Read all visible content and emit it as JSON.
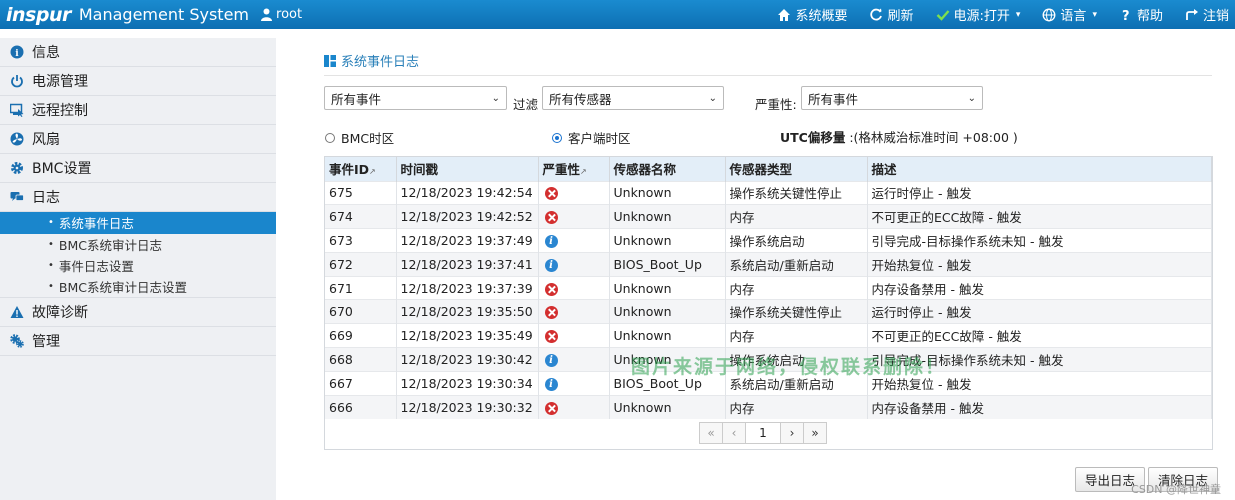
{
  "header": {
    "brand": "inspur",
    "app_name": "Management System",
    "user": "root",
    "nav": [
      {
        "label": "系统概要",
        "icon": "home-icon"
      },
      {
        "label": "刷新",
        "icon": "refresh-icon"
      },
      {
        "label": "电源:打开",
        "icon": "check-icon",
        "caret": "▾"
      },
      {
        "label": "语言",
        "icon": "globe-icon",
        "caret": "▾"
      },
      {
        "label": "帮助",
        "icon": "help-icon"
      },
      {
        "label": "注销",
        "icon": "logout-icon"
      }
    ]
  },
  "sidebar": {
    "items": [
      {
        "label": "信息",
        "icon": "info-icon"
      },
      {
        "label": "电源管理",
        "icon": "power-icon"
      },
      {
        "label": "远程控制",
        "icon": "monitor-icon"
      },
      {
        "label": "风扇",
        "icon": "fan-icon"
      },
      {
        "label": "BMC设置",
        "icon": "gear-icon"
      },
      {
        "label": "日志",
        "icon": "chat-icon"
      }
    ],
    "log_subitems": [
      {
        "label": "系统事件日志",
        "active": true
      },
      {
        "label": "BMC系统审计日志"
      },
      {
        "label": "事件日志设置"
      },
      {
        "label": "BMC系统审计日志设置"
      }
    ],
    "items_after": [
      {
        "label": "故障诊断",
        "icon": "warning-icon"
      },
      {
        "label": "管理",
        "icon": "gears-icon"
      }
    ]
  },
  "main": {
    "title": "系统事件日志",
    "filters": {
      "event_select": "所有事件",
      "filter_label": "过滤",
      "sensor_select": "所有传感器",
      "severity_label": "严重性:",
      "severity_select": "所有事件"
    },
    "timezone": {
      "bmc_label": "BMC时区",
      "client_label": "客户端时区",
      "selected": "client",
      "utc_label": "UTC偏移量",
      "utc_value": ":(格林威治标准时间 +08:00 )"
    },
    "table": {
      "columns": [
        "事件ID",
        "时间戳",
        "严重性",
        "传感器名称",
        "传感器类型",
        "描述"
      ],
      "rows": [
        {
          "id": "675",
          "time": "12/18/2023 19:42:54",
          "sev": "error",
          "sensor": "Unknown",
          "type": "操作系统关键性停止",
          "desc": "运行时停止 - 触发"
        },
        {
          "id": "674",
          "time": "12/18/2023 19:42:52",
          "sev": "error",
          "sensor": "Unknown",
          "type": "内存",
          "desc": "不可更正的ECC故障 - 触发"
        },
        {
          "id": "673",
          "time": "12/18/2023 19:37:49",
          "sev": "info",
          "sensor": "Unknown",
          "type": "操作系统启动",
          "desc": "引导完成-目标操作系统未知 - 触发"
        },
        {
          "id": "672",
          "time": "12/18/2023 19:37:41",
          "sev": "info",
          "sensor": "BIOS_Boot_Up",
          "type": "系统启动/重新启动",
          "desc": "开始热复位 - 触发"
        },
        {
          "id": "671",
          "time": "12/18/2023 19:37:39",
          "sev": "error",
          "sensor": "Unknown",
          "type": "内存",
          "desc": "内存设备禁用 - 触发"
        },
        {
          "id": "670",
          "time": "12/18/2023 19:35:50",
          "sev": "error",
          "sensor": "Unknown",
          "type": "操作系统关键性停止",
          "desc": "运行时停止 - 触发"
        },
        {
          "id": "669",
          "time": "12/18/2023 19:35:49",
          "sev": "error",
          "sensor": "Unknown",
          "type": "内存",
          "desc": "不可更正的ECC故障 - 触发"
        },
        {
          "id": "668",
          "time": "12/18/2023 19:30:42",
          "sev": "info",
          "sensor": "Unknown",
          "type": "操作系统启动",
          "desc": "引导完成-目标操作系统未知 - 触发"
        },
        {
          "id": "667",
          "time": "12/18/2023 19:30:34",
          "sev": "info",
          "sensor": "BIOS_Boot_Up",
          "type": "系统启动/重新启动",
          "desc": "开始热复位 - 触发"
        },
        {
          "id": "666",
          "time": "12/18/2023 19:30:32",
          "sev": "error",
          "sensor": "Unknown",
          "type": "内存",
          "desc": "内存设备禁用 - 触发"
        }
      ]
    },
    "pager": {
      "first": "«",
      "prev": "‹",
      "page": "1",
      "next": "›",
      "last": "»"
    },
    "buttons": {
      "export": "导出日志",
      "clear": "清除日志"
    }
  },
  "overlay": {
    "watermark": "图片来源于网络，侵权联系删除！",
    "csdn": "CSDN @降世神童"
  },
  "colors": {
    "header": "#0d6fb3",
    "accent": "#1a86cc",
    "error": "#d32f2f",
    "info": "#2a86d1"
  }
}
